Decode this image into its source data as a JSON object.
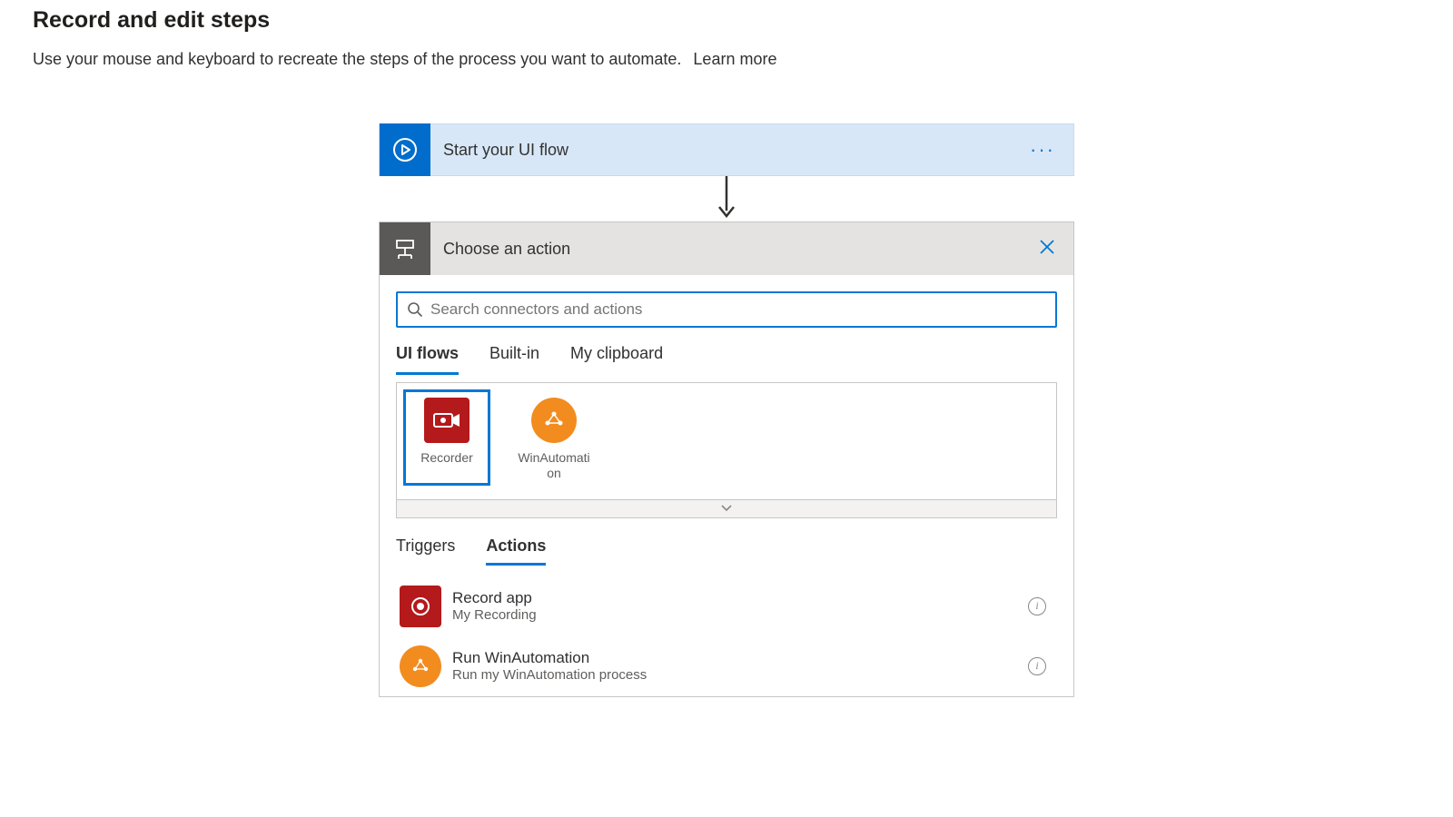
{
  "header": {
    "title": "Record and edit steps",
    "subtitle": "Use your mouse and keyboard to recreate the steps of the process you want to automate.",
    "learn_more": "Learn more"
  },
  "start_card": {
    "label": "Start your UI flow"
  },
  "action_picker": {
    "title": "Choose an action",
    "search_placeholder": "Search connectors and actions",
    "tabs": {
      "ui_flows": "UI flows",
      "built_in": "Built-in",
      "my_clipboard": "My clipboard"
    },
    "connectors": {
      "recorder": "Recorder",
      "winautomation": "WinAutomation"
    },
    "sub_tabs": {
      "triggers": "Triggers",
      "actions": "Actions"
    },
    "list": {
      "record_app": {
        "title": "Record app",
        "sub": "My Recording"
      },
      "run_winauto": {
        "title": "Run WinAutomation",
        "sub": "Run my WinAutomation process"
      }
    }
  }
}
